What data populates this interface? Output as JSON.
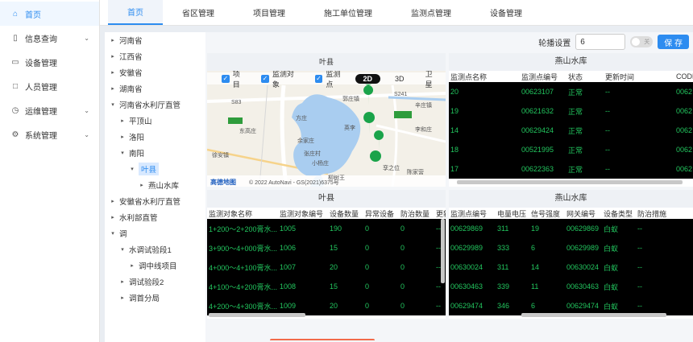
{
  "sidebar": {
    "items": [
      {
        "label": "首页",
        "icon": "home-icon",
        "glyph": "⌂"
      },
      {
        "label": "信息查询",
        "icon": "document-icon",
        "glyph": "▯",
        "chev": "⌄"
      },
      {
        "label": "设备管理",
        "icon": "card-icon",
        "glyph": "▭"
      },
      {
        "label": "人员管理",
        "icon": "square-icon",
        "glyph": "□"
      },
      {
        "label": "运维管理",
        "icon": "clock-icon",
        "glyph": "◷",
        "chev": "⌄"
      },
      {
        "label": "系统管理",
        "icon": "gear-icon",
        "glyph": "⚙",
        "chev": "⌄"
      }
    ]
  },
  "tabs": [
    "首页",
    "省区管理",
    "项目管理",
    "施工单位管理",
    "监测点管理",
    "设备管理"
  ],
  "tree": [
    {
      "label": "河南省",
      "depth": 0,
      "arrow": "▸"
    },
    {
      "label": "江西省",
      "depth": 0,
      "arrow": "▸"
    },
    {
      "label": "安徽省",
      "depth": 0,
      "arrow": "▸"
    },
    {
      "label": "湖南省",
      "depth": 0,
      "arrow": "▸"
    },
    {
      "label": "河南省水利厅直管",
      "depth": 0,
      "arrow": "▾"
    },
    {
      "label": "平顶山",
      "depth": 1,
      "arrow": "▸"
    },
    {
      "label": "洛阳",
      "depth": 1,
      "arrow": "▸"
    },
    {
      "label": "南阳",
      "depth": 1,
      "arrow": "▾"
    },
    {
      "label": "叶县",
      "depth": 2,
      "arrow": "▾",
      "selected": true
    },
    {
      "label": "燕山水库",
      "depth": 3,
      "arrow": "▸"
    },
    {
      "label": "安徽省水利厅直管",
      "depth": 0,
      "arrow": "▸"
    },
    {
      "label": "水利部直管",
      "depth": 0,
      "arrow": "▸"
    },
    {
      "label": "调",
      "depth": 0,
      "arrow": "▾"
    },
    {
      "label": "水调试验段1",
      "depth": 1,
      "arrow": "▾"
    },
    {
      "label": "调中线项目",
      "depth": 2,
      "arrow": "▸"
    },
    {
      "label": "调试验段2",
      "depth": 1,
      "arrow": "▸"
    },
    {
      "label": "调首分局",
      "depth": 1,
      "arrow": "▸"
    }
  ],
  "controls": {
    "rotation_label": "轮播设置",
    "rotation_value": "6",
    "switch_label": "关",
    "save_label": "保 存"
  },
  "panels": {
    "map": {
      "title": "叶县",
      "checks": [
        "项目",
        "监测对象",
        "监测点"
      ],
      "modes": [
        "2D",
        "3D",
        "卫星"
      ],
      "active_mode": "2D",
      "labels": [
        "S83",
        "郭庄镇",
        "S241",
        "辛庄镇",
        "方庄",
        "东高庄",
        "余家庄",
        "英李",
        "李和庄",
        "徐安镇",
        "张庄村",
        "小杨庄",
        "柳树王",
        "孪之位",
        "陈家营",
        "高德地图",
        "© 2022 AutoNavi - GS(2021)6375号"
      ]
    },
    "right_top": {
      "title": "燕山水库",
      "headers": [
        "监测点名称",
        "监测点编号",
        "状态",
        "更新时间",
        "CODE"
      ],
      "rows": [
        [
          "20",
          "00623107",
          "正常",
          "--",
          "0062"
        ],
        [
          "19",
          "00621632",
          "正常",
          "--",
          "0062"
        ],
        [
          "14",
          "00629424",
          "正常",
          "--",
          "0062"
        ],
        [
          "18",
          "00521995",
          "正常",
          "--",
          "0062"
        ],
        [
          "17",
          "00622363",
          "正常",
          "--",
          "0062"
        ]
      ]
    },
    "left_bottom": {
      "title": "叶县",
      "headers": [
        "监测对象名称",
        "监测对象编号",
        "设备数量",
        "异常设备",
        "防治数量",
        "更新"
      ],
      "rows": [
        [
          "1+200～2+200膏水...",
          "1005",
          "190",
          "0",
          "0",
          "--"
        ],
        [
          "3+900～4+000膏水...",
          "1006",
          "15",
          "0",
          "0",
          "--"
        ],
        [
          "4+000～4+100膏水...",
          "1007",
          "20",
          "0",
          "0",
          "--"
        ],
        [
          "4+100～4+200膏水...",
          "1008",
          "15",
          "0",
          "0",
          "--"
        ],
        [
          "4+200～4+300膏水...",
          "1009",
          "20",
          "0",
          "0",
          "--"
        ]
      ]
    },
    "right_bottom": {
      "title": "燕山水库",
      "headers": [
        "监测点编号",
        "电量电压",
        "信号强度",
        "网关编号",
        "设备类型",
        "防治措施"
      ],
      "rows": [
        [
          "00629869",
          "311",
          "19",
          "00629869",
          "白蚁",
          "--"
        ],
        [
          "00629989",
          "333",
          "6",
          "00629989",
          "白蚁",
          "--"
        ],
        [
          "00630024",
          "311",
          "14",
          "00630024",
          "白蚁",
          "--"
        ],
        [
          "00630463",
          "339",
          "11",
          "00630463",
          "白蚁",
          "--"
        ],
        [
          "00629474",
          "346",
          "6",
          "00629474",
          "白蚁",
          "--"
        ]
      ]
    }
  },
  "colors": {
    "accent": "#2d8cf0",
    "table_text": "#22c55e",
    "marker": "#1aa34a"
  }
}
